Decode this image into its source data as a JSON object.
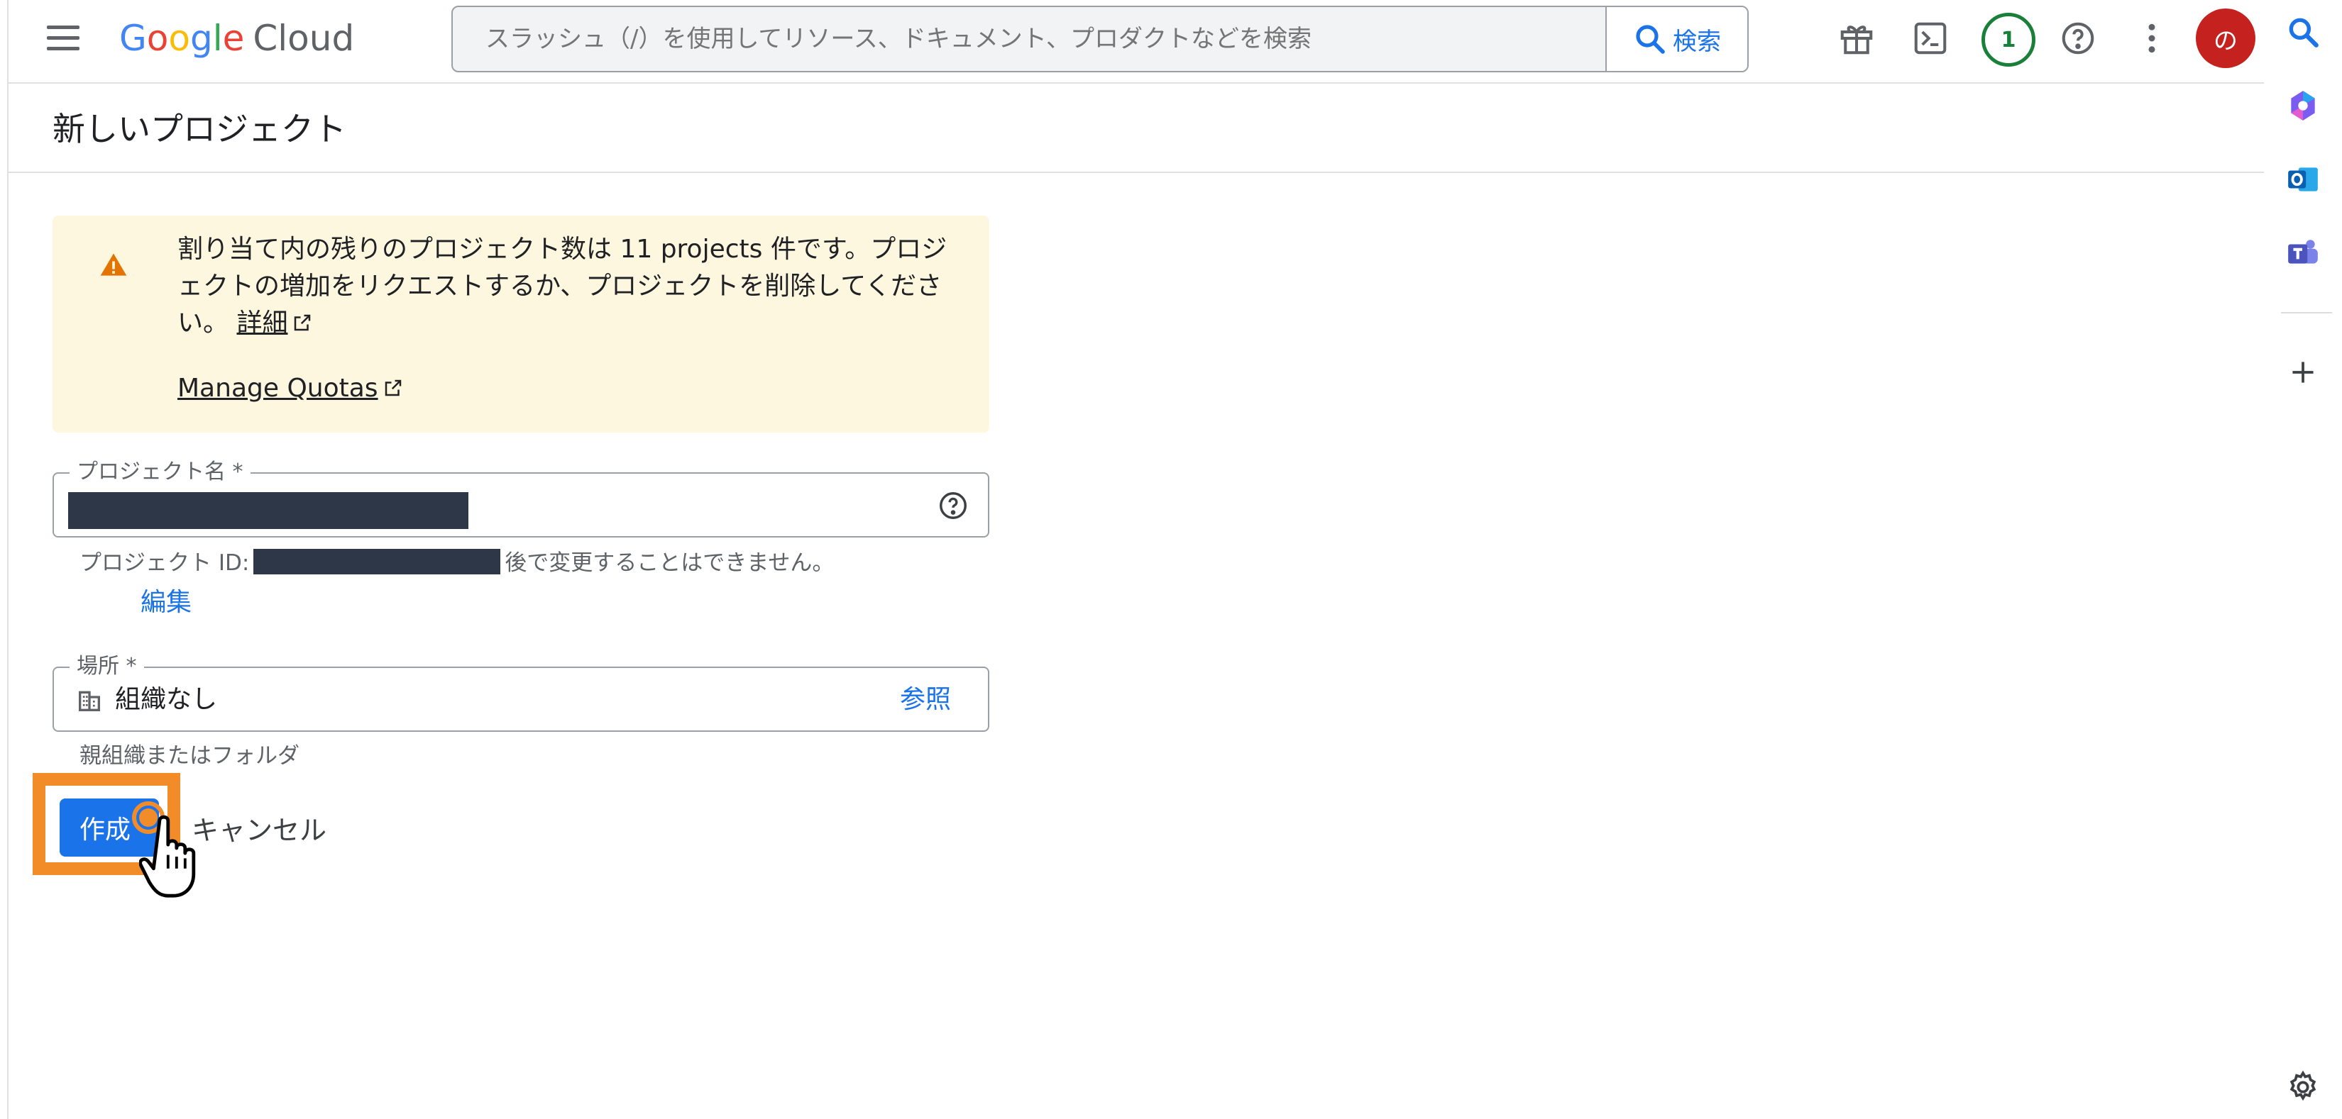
{
  "header": {
    "logo_google": "Google",
    "logo_cloud": "Cloud",
    "search_placeholder": "スラッシュ（/）を使用してリソース、ドキュメント、プロダクトなどを検索",
    "search_button": "検索",
    "notification_count": "1",
    "avatar_initial": "の"
  },
  "page": {
    "title": "新しいプロジェクト"
  },
  "warning": {
    "message": "割り当て内の残りのプロジェクト数は 11 projects 件です。プロジェクトの増加をリクエストするか、プロジェクトを削除してください。",
    "details_link": "詳細",
    "manage_quotas_link": "Manage Quotas"
  },
  "form": {
    "project_name_label": "プロジェクト名 *",
    "project_id_prefix": "プロジェクト ID:",
    "project_id_suffix": "後で変更することはできません。",
    "edit_link": "編集",
    "location_label": "場所 *",
    "location_value": "組織なし",
    "browse_link": "参照",
    "location_hint": "親組織またはフォルダ"
  },
  "actions": {
    "create": "作成",
    "cancel": "キャンセル"
  },
  "colors": {
    "primary": "#1a73e8",
    "warning_bg": "#fef7e0",
    "warning_icon": "#e37400",
    "highlight": "#f28c28",
    "avatar": "#c5221f",
    "badge": "#188038"
  },
  "icons": [
    "menu-icon",
    "search-icon",
    "gift-icon",
    "terminal-icon",
    "help-icon",
    "more-vert-icon",
    "warning-icon",
    "external-link-icon",
    "building-icon",
    "gear-icon",
    "plus-icon"
  ]
}
